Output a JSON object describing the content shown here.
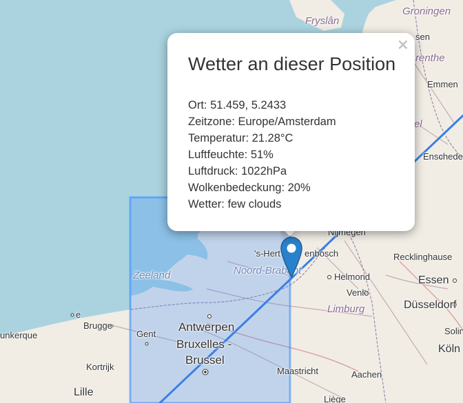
{
  "popup": {
    "title": "Wetter an dieser Position",
    "close_glyph": "×",
    "rows": [
      {
        "label": "Ort",
        "value": "51.459, 5.2433"
      },
      {
        "label": "Zeitzone",
        "value": "Europe/Amsterdam"
      },
      {
        "label": "Temperatur",
        "value": "21.28°C"
      },
      {
        "label": "Luftfeuchte",
        "value": "51%"
      },
      {
        "label": "Luftdruck",
        "value": "1022hPa"
      },
      {
        "label": "Wolkenbedeckung",
        "value": "20%"
      },
      {
        "label": "Wetter",
        "value": "few clouds"
      }
    ],
    "row_texts": [
      "Ort: 51.459, 5.2433",
      "Zeitzone: Europe/Amsterdam",
      "Temperatur: 21.28°C",
      "Luftfeuchte: 51%",
      "Luftdruck: 1022hPa",
      "Wolkenbedeckung: 20%",
      "Wetter: few clouds"
    ]
  },
  "map": {
    "marker_icon": "map-marker-icon",
    "colors": {
      "sea": "#aad3df",
      "land": "#f1ede5",
      "selection_fill": "#9fbdf0",
      "selection_border": "#3388ff",
      "route_line": "#3a7fe6",
      "marker": "#2a81cb"
    },
    "labels": {
      "groningen": "Groningen",
      "fryslan": "Fryslân",
      "sen": "sen",
      "renthe": "renthe",
      "emmen": "Emmen",
      "el": "el",
      "ensched": "Enschede",
      "nijmegen": "Nijmegen",
      "hertogenbosch_part1": "'s-Hert",
      "hertogenbosch_part2": "enbosch",
      "recklinghausen": "Recklinghause",
      "zeeland": "Zeeland",
      "noord_brabant": "Noord-Brabant",
      "helmond": "Helmond",
      "essen": "Essen",
      "venlo": "Venlo",
      "limburg": "Limburg",
      "dusseldorf": "Düsseldorf",
      "solin": "Solin",
      "brugge": "Brugge",
      "gent": "Gent",
      "antwerpen": "Antwerpen",
      "bruxelles": "Bruxelles -",
      "brussel": "Brussel",
      "koln": "Köln",
      "dunkerque": "unkerque",
      "kortrijk": "Kortrijk",
      "maastricht": "Maastricht",
      "aachen": "Aachen",
      "lille": "Lille",
      "liege": "Liège",
      "e_label": "e"
    }
  }
}
